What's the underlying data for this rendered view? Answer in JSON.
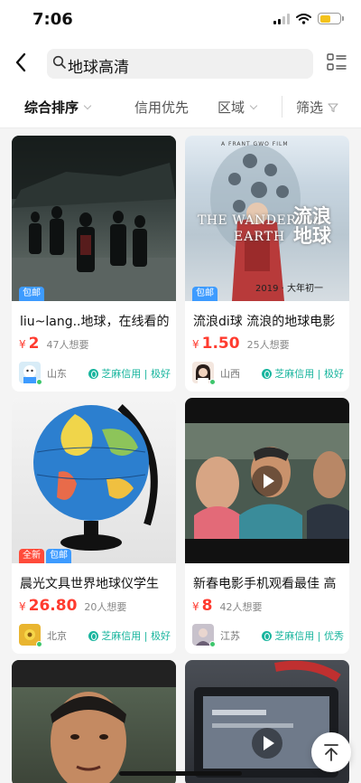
{
  "status_bar": {
    "time": "7:06"
  },
  "search": {
    "query": "地球高清"
  },
  "filters": [
    {
      "label": "综合排序"
    },
    {
      "label": "信用优先"
    },
    {
      "label": "区域"
    },
    {
      "label": "筛选"
    }
  ],
  "items": [
    {
      "title": "liu~lang..地球，在线看的",
      "currency": "¥",
      "price": "2",
      "wants": "47人想要",
      "region": "山东",
      "credit": "芝麻信用 | 极好",
      "tags": [
        "包邮"
      ]
    },
    {
      "title": "流浪di球 流浪的地球电影",
      "currency": "¥",
      "price": "1.50",
      "wants": "25人想要",
      "region": "山西",
      "credit": "芝麻信用 | 极好",
      "tags": [
        "包邮"
      ]
    },
    {
      "title": "晨光文具世界地球仪学生",
      "currency": "¥",
      "price": "26.80",
      "wants": "20人想要",
      "region": "北京",
      "credit": "芝麻信用 | 极好",
      "tags": [
        "全新",
        "包邮"
      ]
    },
    {
      "title": "新春电影手机观看最佳 高",
      "currency": "¥",
      "price": "8",
      "wants": "42人想要",
      "region": "江苏",
      "credit": "芝麻信用 | 优秀",
      "tags": []
    }
  ],
  "poster": {
    "brand": "A FRANT GWO FILM",
    "title_en_1": "THE WANDERING",
    "title_en_2": "EARTH",
    "title_cn": "流浪地球",
    "date": "2019 · 大年初一"
  },
  "colors": {
    "price": "#ff3b2f",
    "credit": "#19b59e",
    "tag_blue": "#3d9bff",
    "tag_red": "#ff4b3a"
  },
  "icons": [
    "back-arrow-icon",
    "search-icon",
    "grid-toggle-icon",
    "chevron-down-icon",
    "filter-funnel-icon",
    "play-icon",
    "back-to-top-icon",
    "sesame-credit-icon"
  ]
}
